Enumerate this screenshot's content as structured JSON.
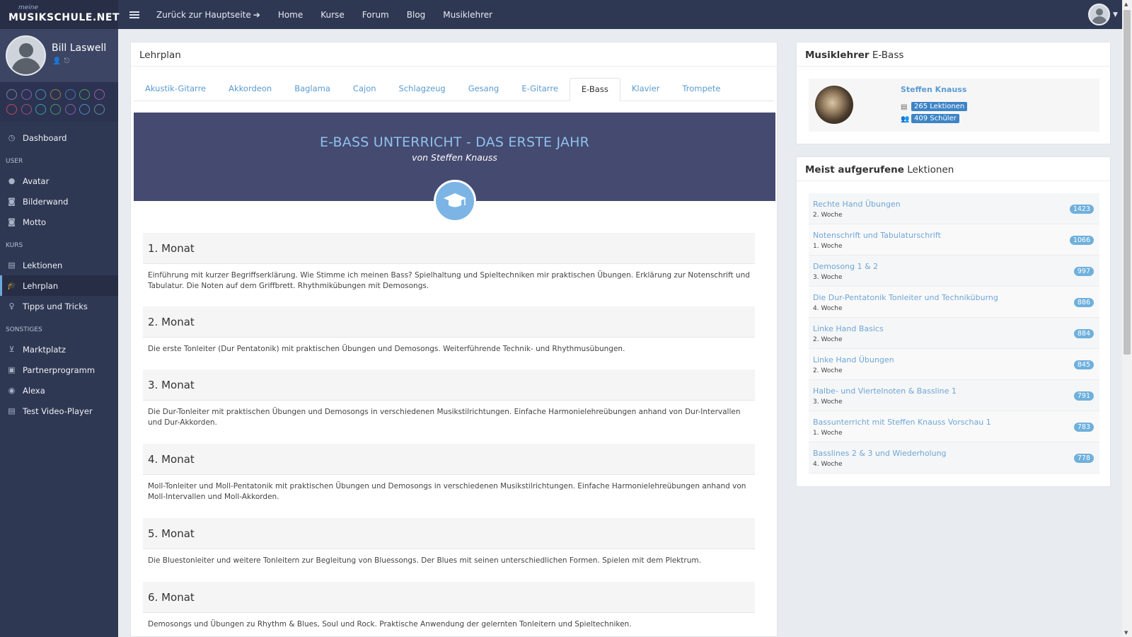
{
  "brand": {
    "small": "meine",
    "main": "MUSIKSCHULE.NET"
  },
  "nav": {
    "back": "Zurück zur Hauptseite",
    "items": [
      "Home",
      "Kurse",
      "Forum",
      "Blog",
      "Musiklehrer"
    ]
  },
  "user": {
    "name": "Bill Laswell"
  },
  "sidebar": {
    "dashboard": "Dashboard",
    "sections": {
      "user": "USER",
      "kurs": "KURS",
      "sonstiges": "SONSTIGES"
    },
    "user_items": [
      "Avatar",
      "Bilderwand",
      "Motto"
    ],
    "kurs_items": [
      "Lektionen",
      "Lehrplan",
      "Tipps und Tricks"
    ],
    "sonstiges_items": [
      "Marktplatz",
      "Partnerprogramm",
      "Alexa",
      "Test Video-Player"
    ],
    "dot_colors_row1": [
      "#7b8398",
      "#8a5fb0",
      "#4f8fc0",
      "#9a7a4a",
      "#4a78b8",
      "#4f9a6a",
      "#a05aa8"
    ],
    "dot_colors_row2": [
      "#c04a5a",
      "#a0507a",
      "#3aa0a0",
      "#4f9a6a",
      "#8a5fb0",
      "#4f8fc0",
      "#6a8a9a"
    ]
  },
  "main": {
    "title": "Lehrplan",
    "tabs": [
      "Akustik-Gitarre",
      "Akkordeon",
      "Baglama",
      "Cajon",
      "Schlagzeug",
      "Gesang",
      "E-Gitarre",
      "E-Bass",
      "Klavier",
      "Trompete"
    ],
    "active_tab": "E-Bass",
    "banner_title": "E-BASS UNTERRICHT - DAS ERSTE JAHR",
    "banner_sub": "von Steffen Knauss",
    "months": [
      {
        "title": "1. Monat",
        "text": "Einführung mit kurzer Begriffserklärung. Wie Stimme ich meinen Bass? Spielhaltung und Spieltechniken mir praktischen Übungen. Erklärung zur Notenschrift und Tabulatur. Die Noten auf dem Griffbrett. Rhythmikübungen mit Demosongs."
      },
      {
        "title": "2. Monat",
        "text": "Die erste Tonleiter (Dur Pentatonik) mit praktischen Übungen und Demosongs. Weiterführende Technik- und Rhythmusübungen."
      },
      {
        "title": "3. Monat",
        "text": "Die Dur-Tonleiter mit praktischen Übungen und Demosongs in verschiedenen Musikstilrichtungen. Einfache Harmonielehreübungen anhand von Dur-Intervallen und Dur-Akkorden."
      },
      {
        "title": "4. Monat",
        "text": "Moll-Tonleiter und Moll-Pentatonik mit praktischen Übungen und Demosongs in verschiedenen Musikstilrichtungen. Einfache Harmonielehreübungen anhand von Moll-Intervallen und Moll-Akkorden."
      },
      {
        "title": "5. Monat",
        "text": "Die Bluestonleiter und weitere Tonleitern zur Begleitung von Bluessongs. Der Blues mit seinen unterschiedlichen Formen. Spielen mit dem Plektrum."
      },
      {
        "title": "6. Monat",
        "text": "Demosongs und Übungen zu Rhythm & Blues, Soul und Rock. Praktische Anwendung der gelernten Tonleitern und Spieltechniken."
      }
    ]
  },
  "teacher": {
    "title_bold": "Musiklehrer",
    "title_rest": "E-Bass",
    "name": "Steffen Knauss",
    "lessons": "265 Lektionen",
    "students": "409 Schüler"
  },
  "popular": {
    "title_bold": "Meist aufgerufene",
    "title_rest": "Lektionen",
    "items": [
      {
        "title": "Rechte Hand Übungen",
        "week": "2. Woche",
        "count": "1423"
      },
      {
        "title": "Notenschrift und Tabulaturschrift",
        "week": "1. Woche",
        "count": "1066"
      },
      {
        "title": "Demosong 1 & 2",
        "week": "3. Woche",
        "count": "997"
      },
      {
        "title": "Die Dur-Pentatonik Tonleiter und Techniküburng",
        "week": "4. Woche",
        "count": "886"
      },
      {
        "title": "Linke Hand Basics",
        "week": "2. Woche",
        "count": "884"
      },
      {
        "title": "Linke Hand Übungen",
        "week": "2. Woche",
        "count": "845"
      },
      {
        "title": "Halbe- und Viertelnoten & Bassline 1",
        "week": "3. Woche",
        "count": "791"
      },
      {
        "title": "Bassunterricht mit Steffen Knauss Vorschau 1",
        "week": "1. Woche",
        "count": "783"
      },
      {
        "title": "Basslines 2 & 3 und Wiederholung",
        "week": "4. Woche",
        "count": "778"
      }
    ]
  },
  "colors": {
    "accent": "#5b9bd0",
    "banner": "#454a70",
    "sidebar": "#2f3853"
  }
}
